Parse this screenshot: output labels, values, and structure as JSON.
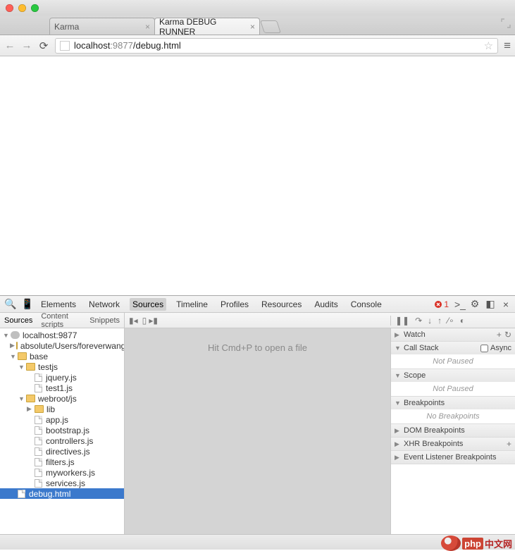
{
  "window": {
    "title": ""
  },
  "tabs": [
    {
      "label": "Karma",
      "active": false
    },
    {
      "label": "Karma DEBUG RUNNER",
      "active": true
    }
  ],
  "address": {
    "host": "localhost",
    "port": ":9877",
    "path": "/debug.html"
  },
  "devtools": {
    "panels": [
      "Elements",
      "Network",
      "Sources",
      "Timeline",
      "Profiles",
      "Resources",
      "Audits",
      "Console"
    ],
    "active_panel": "Sources",
    "error_count": "1",
    "sources_tabs": [
      "Sources",
      "Content scripts",
      "Snippets"
    ],
    "active_sources_tab": "Sources",
    "editor_hint": "Hit Cmd+P to open a file",
    "tree": {
      "origin": "localhost:9877",
      "nodes": [
        {
          "label": "absolute/Users/foreverwang/.",
          "depth": 1,
          "type": "folder",
          "tw": "▶"
        },
        {
          "label": "base",
          "depth": 1,
          "type": "folder",
          "tw": "▼"
        },
        {
          "label": "testjs",
          "depth": 2,
          "type": "folder",
          "tw": "▼"
        },
        {
          "label": "jquery.js",
          "depth": 3,
          "type": "file"
        },
        {
          "label": "test1.js",
          "depth": 3,
          "type": "file"
        },
        {
          "label": "webroot/js",
          "depth": 2,
          "type": "folder",
          "tw": "▼"
        },
        {
          "label": "lib",
          "depth": 3,
          "type": "folder",
          "tw": "▶"
        },
        {
          "label": "app.js",
          "depth": 3,
          "type": "file"
        },
        {
          "label": "bootstrap.js",
          "depth": 3,
          "type": "file"
        },
        {
          "label": "controllers.js",
          "depth": 3,
          "type": "file"
        },
        {
          "label": "directives.js",
          "depth": 3,
          "type": "file"
        },
        {
          "label": "filters.js",
          "depth": 3,
          "type": "file"
        },
        {
          "label": "myworkers.js",
          "depth": 3,
          "type": "file"
        },
        {
          "label": "services.js",
          "depth": 3,
          "type": "file"
        },
        {
          "label": "debug.html",
          "depth": 1,
          "type": "file",
          "selected": true
        }
      ]
    },
    "right": {
      "watch": {
        "title": "Watch"
      },
      "callstack": {
        "title": "Call Stack",
        "status": "Not Paused",
        "async_label": "Async"
      },
      "scope": {
        "title": "Scope",
        "status": "Not Paused"
      },
      "breakpoints": {
        "title": "Breakpoints",
        "status": "No Breakpoints"
      },
      "dom_bp": {
        "title": "DOM Breakpoints"
      },
      "xhr_bp": {
        "title": "XHR Breakpoints"
      },
      "ev_bp": {
        "title": "Event Listener Breakpoints"
      }
    }
  },
  "watermark": "中文网"
}
